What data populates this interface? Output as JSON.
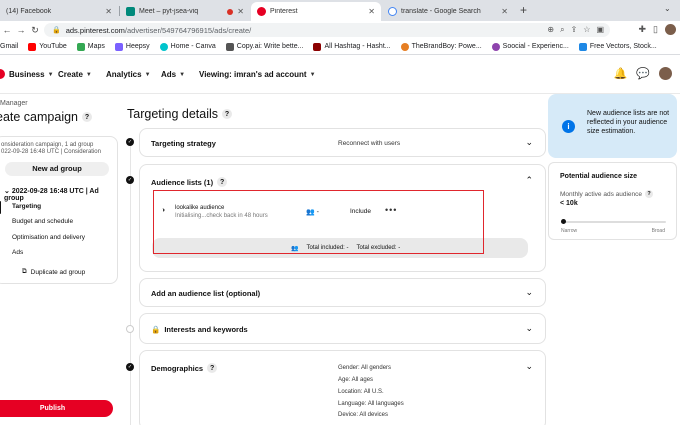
{
  "browser": {
    "tabs": [
      {
        "title": "(14) Facebook",
        "color": "#1877f2",
        "active": false
      },
      {
        "title": "Meet – pyt-jsea-viq",
        "color": "#00897b",
        "active": false
      },
      {
        "title": "Pinterest",
        "color": "#e60023",
        "active": true
      },
      {
        "title": "translate - Google Search",
        "color": "#4285f4",
        "active": false
      }
    ],
    "url_host": "ads.pinterest.com",
    "url_path": "/advertiser/549764796915/ads/create/",
    "bookmarks": [
      {
        "label": "Gmail",
        "color": "#ea4335"
      },
      {
        "label": "YouTube",
        "color": "#ff0000"
      },
      {
        "label": "Maps",
        "color": "#34a853"
      },
      {
        "label": "Heepsy",
        "color": "#7b61ff"
      },
      {
        "label": "Home - Canva",
        "color": "#00c4cc"
      },
      {
        "label": "Copy.ai: Write bette...",
        "color": "#555555"
      },
      {
        "label": "All Hashtag - Hasht...",
        "color": "#8b0000"
      },
      {
        "label": "TheBrandBoy: Powe...",
        "color": "#e67e22"
      },
      {
        "label": "Soocial - Experienc...",
        "color": "#8e44ad"
      },
      {
        "label": "Free Vectors, Stock...",
        "color": "#1e88e5"
      }
    ]
  },
  "nav": {
    "menus": [
      "Business",
      "Create",
      "Analytics",
      "Ads"
    ],
    "viewing": "Viewing: imran's ad account"
  },
  "sidebar": {
    "subtitle": "Manager",
    "title": "eate campaign",
    "campaign_line1": "onsideration campaign, 1 ad group",
    "campaign_line2": "022-09-28 16:48 UTC | Consideration",
    "new_group_label": "New ad group",
    "group_title": "2022-09-28 16:48 UTC | Ad group",
    "items": [
      "Targeting",
      "Budget and schedule",
      "Optimisation and delivery",
      "Ads"
    ],
    "duplicate_label": "Duplicate ad group",
    "publish_label": "Publish"
  },
  "main": {
    "title": "Targeting details",
    "strategy": {
      "label": "Targeting strategy",
      "value": "Reconnect with users"
    },
    "audience_lists": {
      "label": "Audience lists (1)",
      "audience_name": "lookalike audience",
      "status": "Initialising...check back in 48 hours",
      "size": "-",
      "mode": "Include",
      "more": "•••",
      "total_included": "Total included: -",
      "total_excluded": "Total excluded: -"
    },
    "add_audience_label": "Add an audience list (optional)",
    "interests_label": "Interests and keywords",
    "demographics": {
      "label": "Demographics",
      "values": [
        "Gender: All genders",
        "Age: All ages",
        "Location: All U.S.",
        "Language: All languages",
        "Device: All devices"
      ]
    }
  },
  "right": {
    "info_text": "New audience lists are not reflected in your audience size estimation.",
    "potential_title": "Potential audience size",
    "potential_sub": "Monthly active ads audience",
    "potential_value": "< 10k",
    "potential_level": 0.01,
    "narrow_label": "Narrow",
    "broad_label": "Broad"
  }
}
